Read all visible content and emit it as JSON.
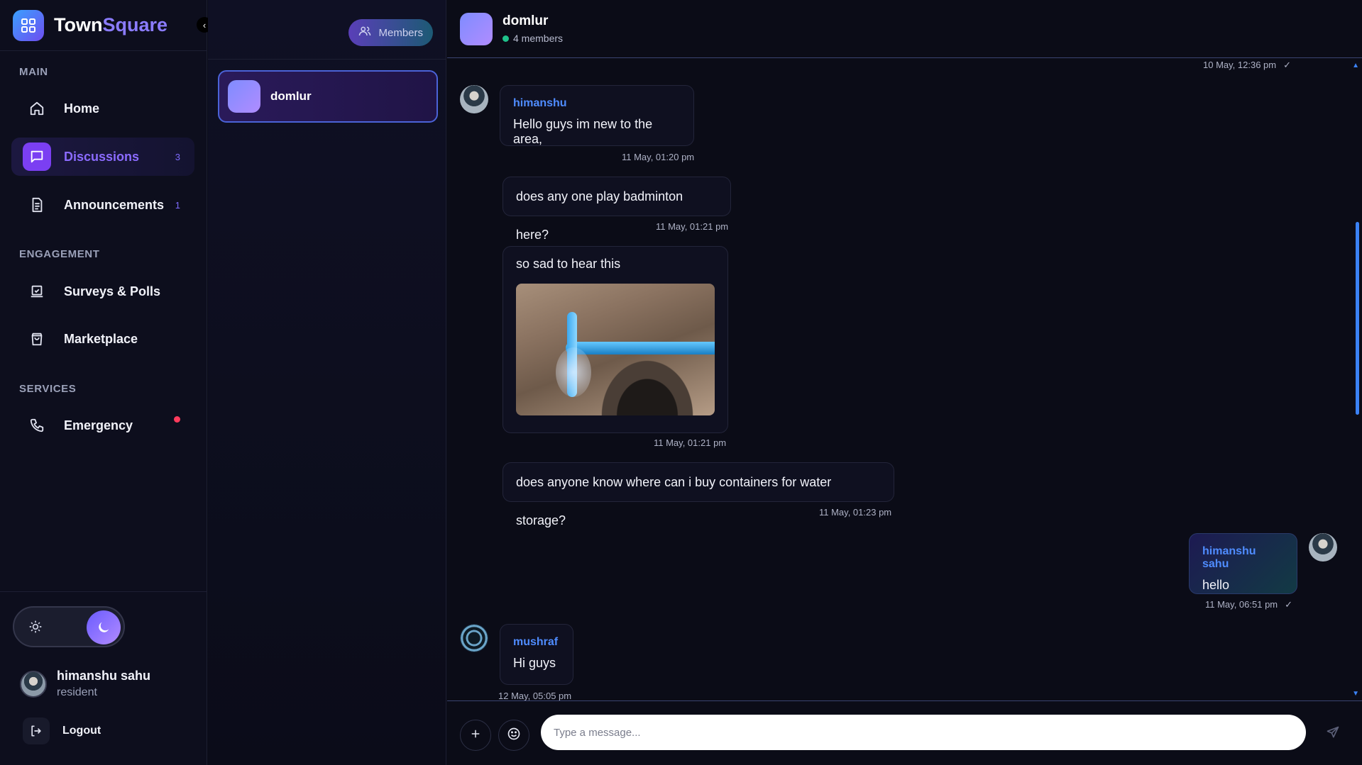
{
  "brand": {
    "name_part1": "Town",
    "name_part2": "Square",
    "logo_icon": "grid-icon"
  },
  "sidebar": {
    "sections": {
      "main": "MAIN",
      "engagement": "ENGAGEMENT",
      "services": "SERVICES"
    },
    "items": [
      {
        "label": "Home",
        "icon": "home-icon"
      },
      {
        "label": "Discussions",
        "icon": "chat-bubble-icon",
        "count": "3",
        "active": true
      },
      {
        "label": "Announcements",
        "icon": "document-icon",
        "count": "1"
      },
      {
        "label": "Surveys & Polls",
        "icon": "poll-icon"
      },
      {
        "label": "Marketplace",
        "icon": "shopping-bag-icon"
      },
      {
        "label": "Emergency",
        "icon": "phone-icon",
        "alert_dot": true
      }
    ]
  },
  "theme": {
    "light_icon": "sun-icon",
    "dark_icon": "moon-icon",
    "mode": "dark"
  },
  "user": {
    "name": "himanshu sahu",
    "role": "resident"
  },
  "logout": {
    "label": "Logout"
  },
  "channels": {
    "members_label": "Members",
    "list": [
      {
        "name": "domlur",
        "selected": true
      }
    ]
  },
  "chat": {
    "title": "domlur",
    "subtitle": "4 members",
    "top_timestamp": "10 May, 12:36 pm",
    "messages": [
      {
        "author": "himanshu",
        "text": "Hello guys im new to the area,",
        "time": "11 May, 01:20 pm"
      },
      {
        "author": "",
        "text": "does any one play badminton here?",
        "time": "11 May, 01:21 pm"
      },
      {
        "author": "",
        "text": "so sad to hear this",
        "time": "11 May, 01:21 pm",
        "image": "water-pipe-leak-photo"
      },
      {
        "author": "",
        "text": "does anyone know where can i buy containers for water storage?",
        "time": "11 May, 01:23 pm"
      },
      {
        "author": "himanshu sahu",
        "text": "hello",
        "time": "11 May, 06:51 pm",
        "mine": true
      },
      {
        "author": "mushraf",
        "text": "Hi guys",
        "time": "12 May, 05:05 pm"
      }
    ]
  },
  "composer": {
    "placeholder": "Type a message...",
    "add_icon": "plus-icon",
    "emoji_icon": "smiley-icon",
    "send_icon": "send-icon"
  }
}
